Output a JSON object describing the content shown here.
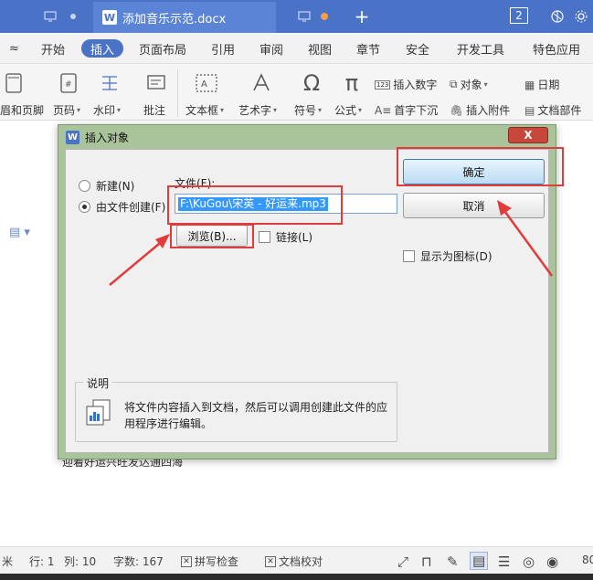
{
  "window": {
    "doc_title": "添加音乐示范.docx",
    "app_badge": "W",
    "new_tab": "+",
    "window_count": "2"
  },
  "menu": {
    "toggle": "≈",
    "items": [
      "开始",
      "插入",
      "页面布局",
      "引用",
      "审阅",
      "视图",
      "章节",
      "安全",
      "开发工具",
      "特色应用"
    ],
    "active": "插入"
  },
  "ribbon": {
    "header_footer": "眉和页脚",
    "page_number": "页码",
    "watermark": "水印",
    "comment": "批注",
    "textbox": "文本框",
    "art_text": "艺术字",
    "symbol": "符号",
    "formula": "公式",
    "insert_number": "插入数字",
    "object": "对象",
    "date": "日期",
    "drop_cap": "首字下沉",
    "attach": "插入附件",
    "doc_part": "文档部件"
  },
  "dialog": {
    "title": "插入对象",
    "close_label": "X",
    "radio_new": "新建(N)",
    "radio_from_file": "由文件创建(F)",
    "file_label": "文件(F):",
    "file_value": "F:\\KuGou\\宋英 - 好运来.mp3",
    "browse_label": "浏览(B)...",
    "link_label": "链接(L)",
    "ok_label": "确定",
    "cancel_label": "取消",
    "show_icon_label": "显示为图标(D)",
    "desc_title": "说明",
    "desc_text": "将文件内容插入到文档，然后可以调用创建此文件的应用程序进行编辑。"
  },
  "document": {
    "body_text": "迎着好运兴旺发达通四海"
  },
  "status": {
    "unit": "米",
    "row": "行: 1",
    "col": "列: 10",
    "word_count": "字数: 167",
    "spell_check": "拼写检查",
    "doc_check": "文档校对",
    "zoom": "80"
  },
  "colors": {
    "title_bar": "#4a73c8",
    "dialog_frame": "#a9c39a",
    "annotation": "#e23b3b",
    "selection": "#3399ff"
  }
}
